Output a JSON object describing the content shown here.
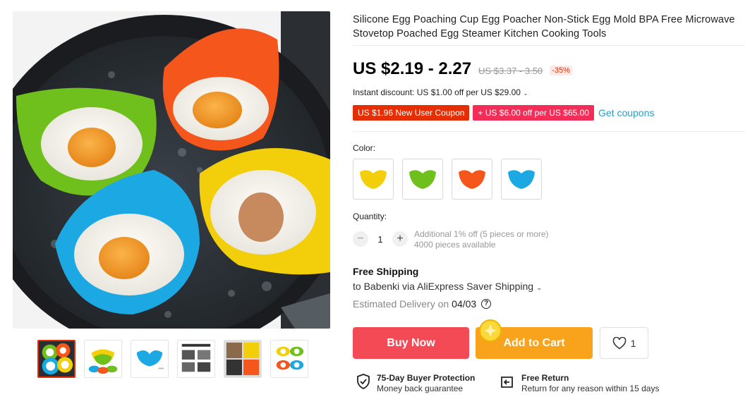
{
  "product": {
    "title": "Silicone Egg Poaching Cup Egg Poacher Non-Stick Egg Mold BPA Free Microwave Stovetop Poached Egg Steamer Kitchen Cooking Tools",
    "price": "US $2.19 - 2.27",
    "original_price": "US $3.37 - 3.50",
    "discount": "-35%"
  },
  "discounts": {
    "instant": "Instant discount: US $1.00 off per US $29.00",
    "coupons": [
      "US $1.96 New User Coupon",
      "+ US $6.00 off per US $65.00"
    ],
    "get_coupons": "Get coupons"
  },
  "color": {
    "label": "Color:",
    "options": [
      {
        "name": "yellow",
        "hex": "#f2cf0a"
      },
      {
        "name": "green",
        "hex": "#6fc01c"
      },
      {
        "name": "orange",
        "hex": "#f5561b"
      },
      {
        "name": "blue",
        "hex": "#1ca8e3"
      }
    ]
  },
  "quantity": {
    "label": "Quantity:",
    "value": "1",
    "minus": "−",
    "plus": "+",
    "note_1": "Additional 1% off (5 pieces or more)",
    "note_2": "4000 pieces available"
  },
  "shipping": {
    "title": "Free Shipping",
    "to": "to Babenki via AliExpress Saver Shipping",
    "delivery_label": "Estimated Delivery on",
    "delivery_date": "04/03"
  },
  "actions": {
    "buy_now": "Buy Now",
    "add_to_cart": "Add to Cart",
    "wishlist_count": "1"
  },
  "guarantees": [
    {
      "title": "75-Day Buyer Protection",
      "subtitle": "Money back guarantee"
    },
    {
      "title": "Free Return",
      "subtitle": "Return for any reason within 15 days"
    }
  ],
  "colors": {
    "accent_red": "#e62e04",
    "buy_now": "#f44a56",
    "add_to_cart": "#f9a21b",
    "link": "#2e9cc3"
  },
  "icons": [
    "shield-check-icon",
    "return-icon",
    "heart-icon",
    "help-icon",
    "chevron-down-icon",
    "coin-icon"
  ]
}
